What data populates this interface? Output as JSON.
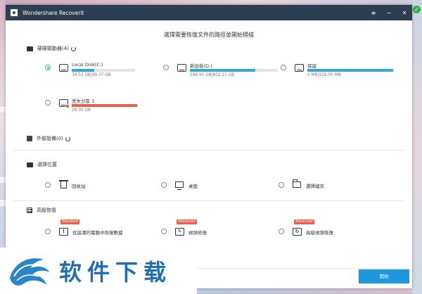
{
  "window": {
    "title": "Wondershare Recoverit",
    "controls": {
      "menu": "≡",
      "minimize": "−",
      "close": "✕"
    }
  },
  "headline": "選擇需要恢復文件的路徑並開始掃描",
  "sections": {
    "hard_drives": {
      "title": "硬碟驅動器(4)"
    },
    "external": {
      "title": "外部設備(0)"
    },
    "location": {
      "title": "選擇位置"
    },
    "advanced": {
      "title": "高級恢復"
    }
  },
  "drives": [
    {
      "name": "Local Disk(C:)",
      "size": "34.53 GB|99.37 GB",
      "used": 0.35,
      "selected": true,
      "lost": false
    },
    {
      "name": "新加卷(D:)",
      "size": "596.95 GB|802.21 GB",
      "used": 0.74,
      "selected": false,
      "lost": false
    },
    {
      "name": "保留",
      "size": "0 MB|529.00 MB",
      "used": 1.0,
      "selected": false,
      "lost": false
    },
    {
      "name": "丢失分區 1",
      "size": "29.30 GB",
      "used": 1.0,
      "selected": false,
      "lost": true
    }
  ],
  "locations": [
    {
      "label": "回收站",
      "icon": "trash-icon"
    },
    {
      "label": "桌面",
      "icon": "desktop-icon"
    },
    {
      "label": "選擇檔夾",
      "icon": "folder-icon"
    }
  ],
  "advanced_items": [
    {
      "label": "從崩潰的電腦中恢復數據",
      "tag": "Standard",
      "glyph": "!"
    },
    {
      "label": "視頻修復",
      "tag": "Advanced",
      "glyph": "✎"
    },
    {
      "label": "高級視頻恢復",
      "tag": "Advanced",
      "glyph": "↻"
    }
  ],
  "start_button": "開始",
  "watermark": {
    "text": "软件下载"
  },
  "desktop": {
    "green_badge": "✓"
  },
  "colors": {
    "accent": "#1e97dc",
    "titlebar": "#2c3e50",
    "lost": "#e8614a"
  }
}
